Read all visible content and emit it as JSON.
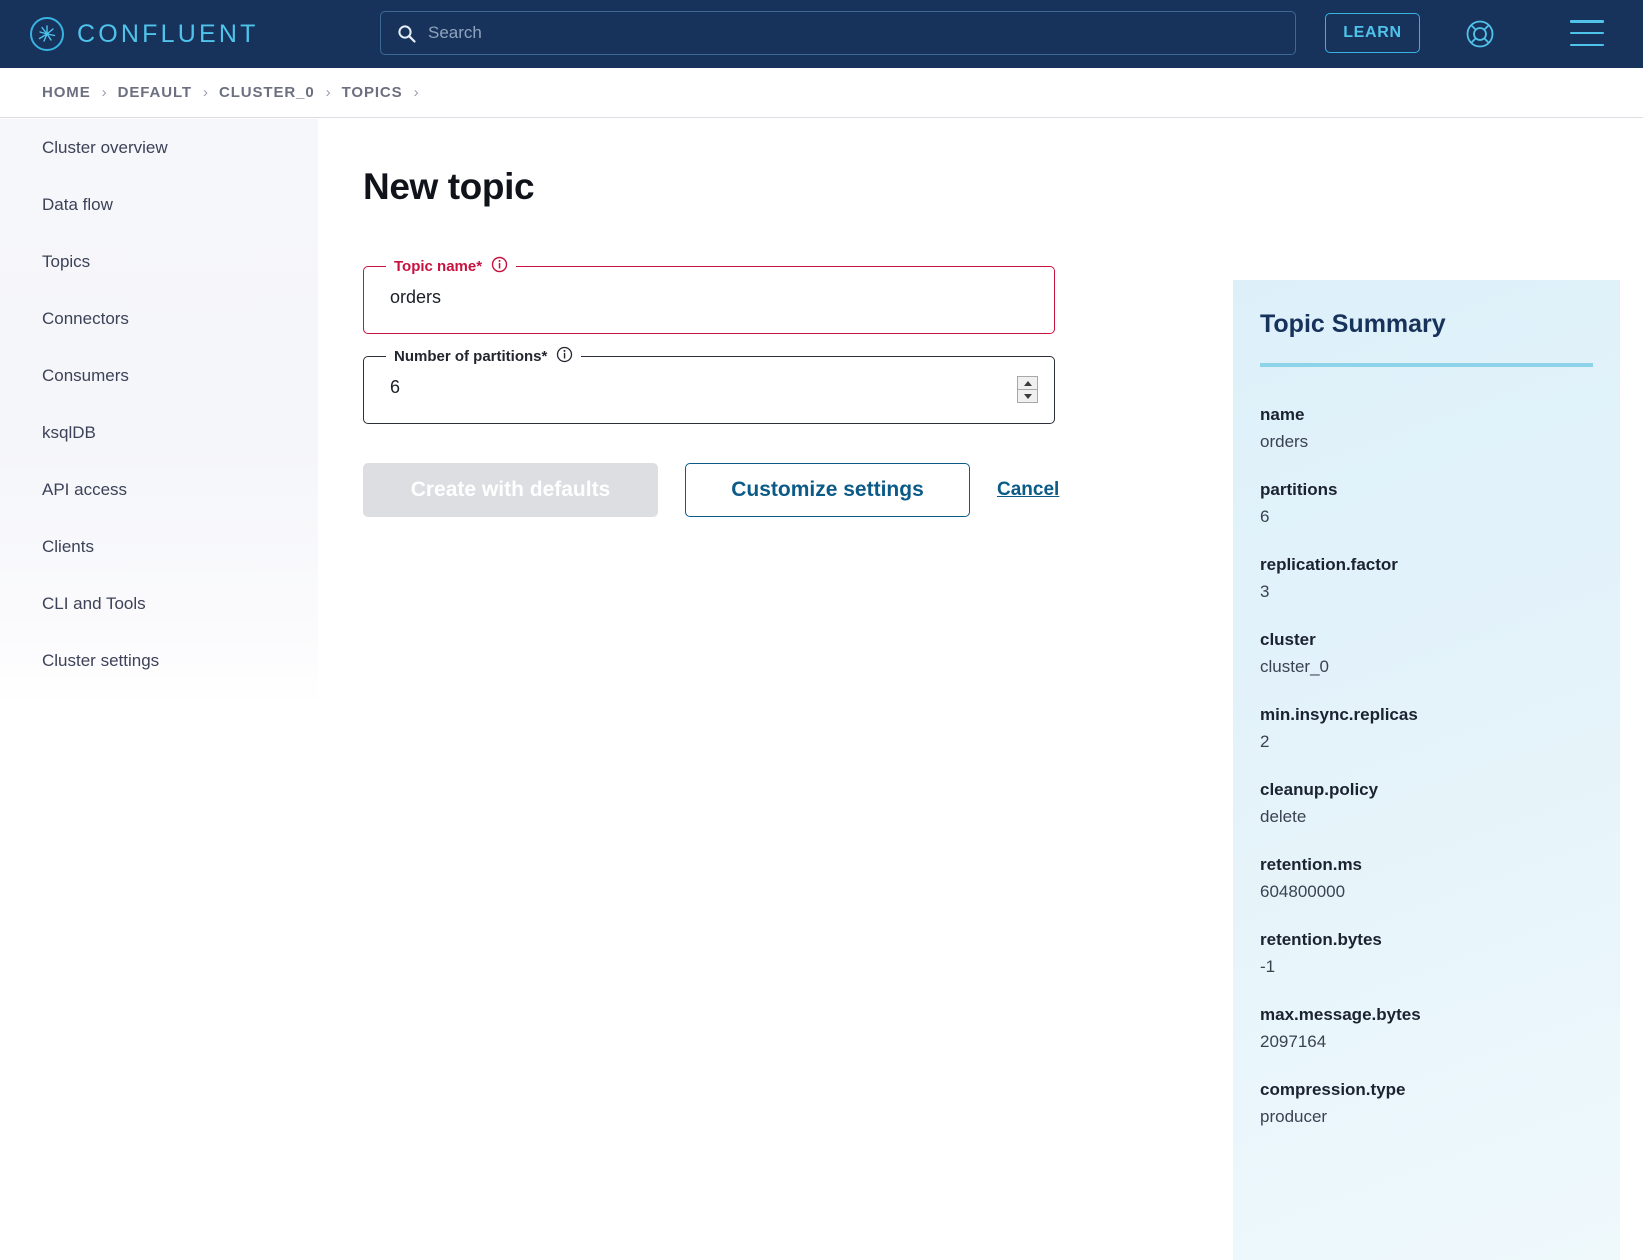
{
  "colors": {
    "nav_bg": "#17325b",
    "accent_cyan": "#4fc3ea",
    "link_blue": "#0b5a87",
    "error_red": "#c7113f",
    "summary_bg": "#ddf0f9",
    "summary_rule": "#8fd3ea"
  },
  "topbar": {
    "brand": "CONFLUENT",
    "brand_icon": "confluent-logo-icon",
    "search": {
      "value": "",
      "placeholder": "Search",
      "icon": "search-icon"
    },
    "learn_label": "LEARN",
    "help_icon": "life-preserver-help-icon",
    "menu_icon": "hamburger-menu-icon"
  },
  "breadcrumb": {
    "items": [
      "HOME",
      "DEFAULT",
      "CLUSTER_0",
      "TOPICS"
    ],
    "separator": "›",
    "trailing_separator": "›"
  },
  "sidebar": {
    "items": [
      {
        "label": "Cluster overview"
      },
      {
        "label": "Data flow"
      },
      {
        "label": "Topics"
      },
      {
        "label": "Connectors"
      },
      {
        "label": "Consumers"
      },
      {
        "label": "ksqlDB"
      },
      {
        "label": "API access"
      },
      {
        "label": "Clients"
      },
      {
        "label": "CLI and Tools"
      },
      {
        "label": "Cluster settings"
      }
    ]
  },
  "main": {
    "title": "New topic",
    "fields": [
      {
        "label": "Topic name*",
        "value": "orders",
        "info_icon": "info-circle-icon",
        "state": "error"
      },
      {
        "label": "Number of partitions*",
        "value": "6",
        "info_icon": "info-circle-icon",
        "state": "normal"
      }
    ],
    "buttons": {
      "create_defaults": "Create with defaults",
      "customize": "Customize settings",
      "cancel": "Cancel"
    }
  },
  "summary": {
    "title": "Topic Summary",
    "rows": [
      {
        "key": "name",
        "value": "orders"
      },
      {
        "key": "partitions",
        "value": "6"
      },
      {
        "key": "replication.factor",
        "value": "3"
      },
      {
        "key": "cluster",
        "value": "cluster_0"
      },
      {
        "key": "min.insync.replicas",
        "value": "2"
      },
      {
        "key": "cleanup.policy",
        "value": "delete"
      },
      {
        "key": "retention.ms",
        "value": "604800000"
      },
      {
        "key": "retention.bytes",
        "value": "-1"
      },
      {
        "key": "max.message.bytes",
        "value": "2097164"
      },
      {
        "key": "compression.type",
        "value": "producer"
      }
    ]
  }
}
